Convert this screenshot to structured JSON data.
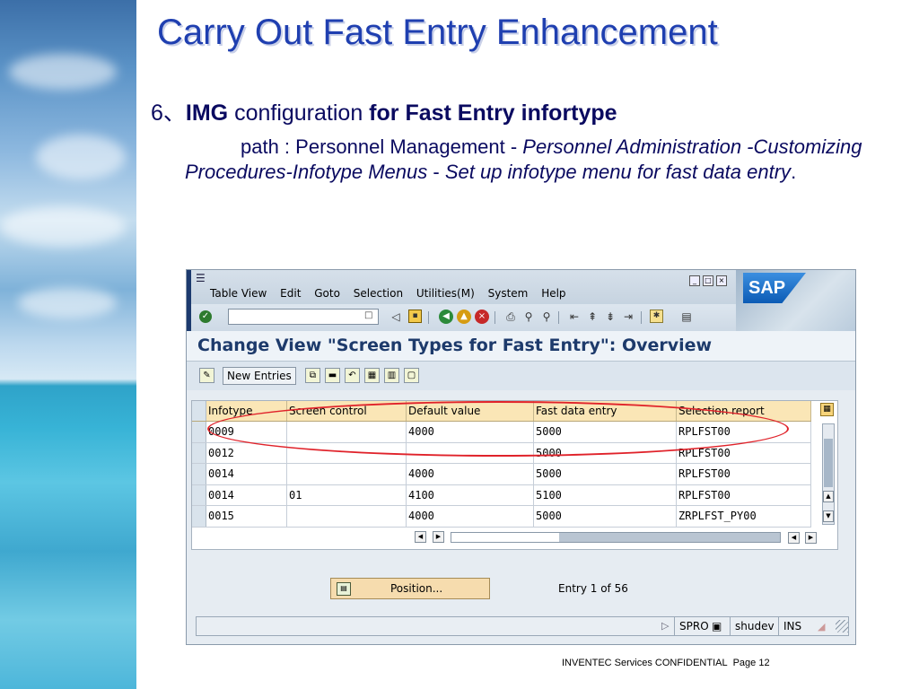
{
  "slide": {
    "title": "Carry Out Fast Entry Enhancement",
    "bullet_num": "6、",
    "bullet_img": "IMG",
    "bullet_mid": " configuration ",
    "bullet_rest": "for Fast Entry infortype",
    "path_prefix": "path : Personnel Management - ",
    "path_italic1": "Personnel Administration -Customizing Procedures-Infotype Menus",
    "path_sep": " - ",
    "path_italic2": "Set up infotype menu for fast data entry",
    "path_end": ".",
    "footer_text": "INVENTEC Services CONFIDENTIAL",
    "footer_page": "Page 12"
  },
  "sap": {
    "menu": [
      "Table View",
      "Edit",
      "Goto",
      "Selection",
      "Utilities(M)",
      "System",
      "Help"
    ],
    "command_field": {
      "value": "",
      "placeholder": ""
    },
    "logo_text": "SAP",
    "view_title": "Change View \"Screen Types for Fast Entry\": Overview",
    "new_entries_label": "New Entries",
    "table": {
      "headers": [
        "Infotype",
        "Screen control",
        "Default value",
        "Fast data entry",
        "Selection report"
      ],
      "rows": [
        [
          "0009",
          "",
          "4000",
          "5000",
          "RPLFST00"
        ],
        [
          "0012",
          "",
          "",
          "5000",
          "RPLFST00"
        ],
        [
          "0014",
          "",
          "4000",
          "5000",
          "RPLFST00"
        ],
        [
          "0014",
          "01",
          "4100",
          "5100",
          "RPLFST00"
        ],
        [
          "0015",
          "",
          "4000",
          "5000",
          "ZRPLFST_PY00"
        ],
        [
          "",
          "",
          "",
          "",
          ""
        ]
      ]
    },
    "position_label": "Position...",
    "entry_info": "Entry 1 of 56",
    "status": {
      "transaction": "SPRO",
      "user": "shudev",
      "mode": "INS"
    },
    "icons": {
      "enter": "check-icon",
      "save": "save-icon",
      "back": "back-icon",
      "exit": "exit-icon",
      "cancel": "cancel-icon"
    },
    "colors": {
      "header_bg": "#fae6b6",
      "title_color": "#1d3a6b",
      "highlight_ellipse": "#e0222a"
    }
  }
}
